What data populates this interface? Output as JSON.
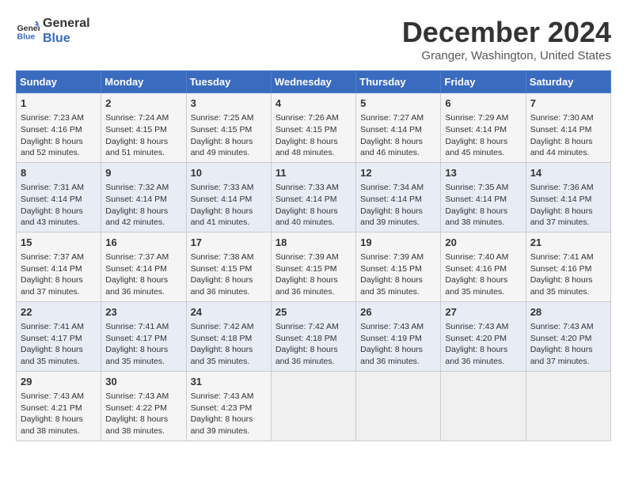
{
  "logo": {
    "line1": "General",
    "line2": "Blue"
  },
  "title": "December 2024",
  "location": "Granger, Washington, United States",
  "days_of_week": [
    "Sunday",
    "Monday",
    "Tuesday",
    "Wednesday",
    "Thursday",
    "Friday",
    "Saturday"
  ],
  "weeks": [
    [
      {
        "day": 1,
        "lines": [
          "Sunrise: 7:23 AM",
          "Sunset: 4:16 PM",
          "Daylight: 8 hours",
          "and 52 minutes."
        ]
      },
      {
        "day": 2,
        "lines": [
          "Sunrise: 7:24 AM",
          "Sunset: 4:15 PM",
          "Daylight: 8 hours",
          "and 51 minutes."
        ]
      },
      {
        "day": 3,
        "lines": [
          "Sunrise: 7:25 AM",
          "Sunset: 4:15 PM",
          "Daylight: 8 hours",
          "and 49 minutes."
        ]
      },
      {
        "day": 4,
        "lines": [
          "Sunrise: 7:26 AM",
          "Sunset: 4:15 PM",
          "Daylight: 8 hours",
          "and 48 minutes."
        ]
      },
      {
        "day": 5,
        "lines": [
          "Sunrise: 7:27 AM",
          "Sunset: 4:14 PM",
          "Daylight: 8 hours",
          "and 46 minutes."
        ]
      },
      {
        "day": 6,
        "lines": [
          "Sunrise: 7:29 AM",
          "Sunset: 4:14 PM",
          "Daylight: 8 hours",
          "and 45 minutes."
        ]
      },
      {
        "day": 7,
        "lines": [
          "Sunrise: 7:30 AM",
          "Sunset: 4:14 PM",
          "Daylight: 8 hours",
          "and 44 minutes."
        ]
      }
    ],
    [
      {
        "day": 8,
        "lines": [
          "Sunrise: 7:31 AM",
          "Sunset: 4:14 PM",
          "Daylight: 8 hours",
          "and 43 minutes."
        ]
      },
      {
        "day": 9,
        "lines": [
          "Sunrise: 7:32 AM",
          "Sunset: 4:14 PM",
          "Daylight: 8 hours",
          "and 42 minutes."
        ]
      },
      {
        "day": 10,
        "lines": [
          "Sunrise: 7:33 AM",
          "Sunset: 4:14 PM",
          "Daylight: 8 hours",
          "and 41 minutes."
        ]
      },
      {
        "day": 11,
        "lines": [
          "Sunrise: 7:33 AM",
          "Sunset: 4:14 PM",
          "Daylight: 8 hours",
          "and 40 minutes."
        ]
      },
      {
        "day": 12,
        "lines": [
          "Sunrise: 7:34 AM",
          "Sunset: 4:14 PM",
          "Daylight: 8 hours",
          "and 39 minutes."
        ]
      },
      {
        "day": 13,
        "lines": [
          "Sunrise: 7:35 AM",
          "Sunset: 4:14 PM",
          "Daylight: 8 hours",
          "and 38 minutes."
        ]
      },
      {
        "day": 14,
        "lines": [
          "Sunrise: 7:36 AM",
          "Sunset: 4:14 PM",
          "Daylight: 8 hours",
          "and 37 minutes."
        ]
      }
    ],
    [
      {
        "day": 15,
        "lines": [
          "Sunrise: 7:37 AM",
          "Sunset: 4:14 PM",
          "Daylight: 8 hours",
          "and 37 minutes."
        ]
      },
      {
        "day": 16,
        "lines": [
          "Sunrise: 7:37 AM",
          "Sunset: 4:14 PM",
          "Daylight: 8 hours",
          "and 36 minutes."
        ]
      },
      {
        "day": 17,
        "lines": [
          "Sunrise: 7:38 AM",
          "Sunset: 4:15 PM",
          "Daylight: 8 hours",
          "and 36 minutes."
        ]
      },
      {
        "day": 18,
        "lines": [
          "Sunrise: 7:39 AM",
          "Sunset: 4:15 PM",
          "Daylight: 8 hours",
          "and 36 minutes."
        ]
      },
      {
        "day": 19,
        "lines": [
          "Sunrise: 7:39 AM",
          "Sunset: 4:15 PM",
          "Daylight: 8 hours",
          "and 35 minutes."
        ]
      },
      {
        "day": 20,
        "lines": [
          "Sunrise: 7:40 AM",
          "Sunset: 4:16 PM",
          "Daylight: 8 hours",
          "and 35 minutes."
        ]
      },
      {
        "day": 21,
        "lines": [
          "Sunrise: 7:41 AM",
          "Sunset: 4:16 PM",
          "Daylight: 8 hours",
          "and 35 minutes."
        ]
      }
    ],
    [
      {
        "day": 22,
        "lines": [
          "Sunrise: 7:41 AM",
          "Sunset: 4:17 PM",
          "Daylight: 8 hours",
          "and 35 minutes."
        ]
      },
      {
        "day": 23,
        "lines": [
          "Sunrise: 7:41 AM",
          "Sunset: 4:17 PM",
          "Daylight: 8 hours",
          "and 35 minutes."
        ]
      },
      {
        "day": 24,
        "lines": [
          "Sunrise: 7:42 AM",
          "Sunset: 4:18 PM",
          "Daylight: 8 hours",
          "and 35 minutes."
        ]
      },
      {
        "day": 25,
        "lines": [
          "Sunrise: 7:42 AM",
          "Sunset: 4:18 PM",
          "Daylight: 8 hours",
          "and 36 minutes."
        ]
      },
      {
        "day": 26,
        "lines": [
          "Sunrise: 7:43 AM",
          "Sunset: 4:19 PM",
          "Daylight: 8 hours",
          "and 36 minutes."
        ]
      },
      {
        "day": 27,
        "lines": [
          "Sunrise: 7:43 AM",
          "Sunset: 4:20 PM",
          "Daylight: 8 hours",
          "and 36 minutes."
        ]
      },
      {
        "day": 28,
        "lines": [
          "Sunrise: 7:43 AM",
          "Sunset: 4:20 PM",
          "Daylight: 8 hours",
          "and 37 minutes."
        ]
      }
    ],
    [
      {
        "day": 29,
        "lines": [
          "Sunrise: 7:43 AM",
          "Sunset: 4:21 PM",
          "Daylight: 8 hours",
          "and 38 minutes."
        ]
      },
      {
        "day": 30,
        "lines": [
          "Sunrise: 7:43 AM",
          "Sunset: 4:22 PM",
          "Daylight: 8 hours",
          "and 38 minutes."
        ]
      },
      {
        "day": 31,
        "lines": [
          "Sunrise: 7:43 AM",
          "Sunset: 4:23 PM",
          "Daylight: 8 hours",
          "and 39 minutes."
        ]
      },
      null,
      null,
      null,
      null
    ]
  ]
}
